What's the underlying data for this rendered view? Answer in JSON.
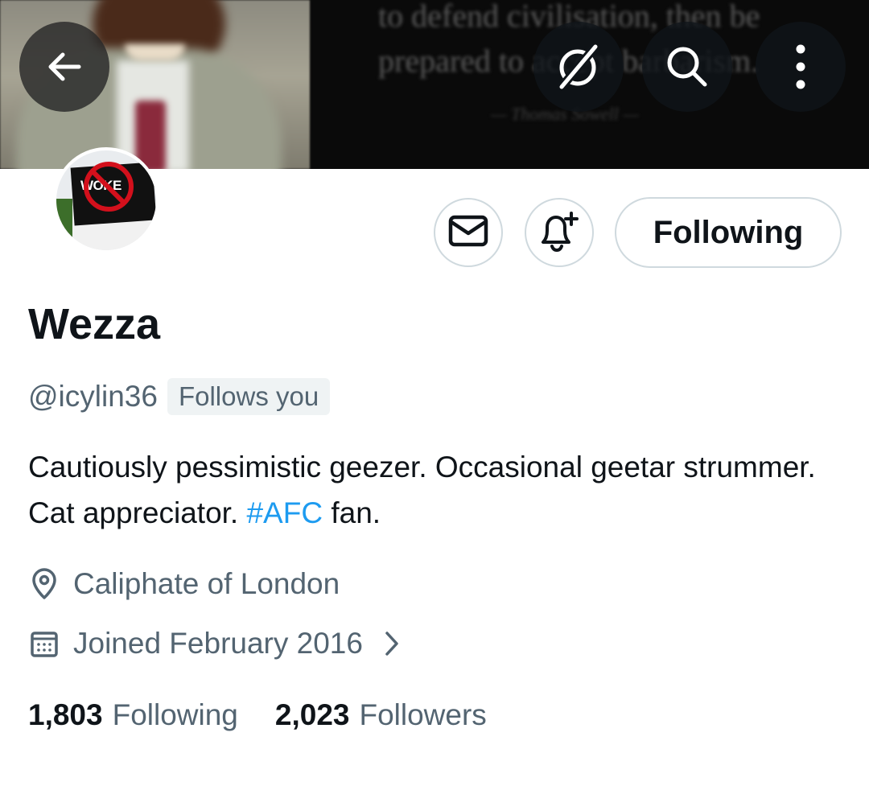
{
  "banner": {
    "quote_line1": "to defend civilisation, then be",
    "quote_line2": "prepared to accept barbarism.",
    "quote_cite": "— Thomas Sowell —"
  },
  "nav": {
    "back_icon": "arrow-left-icon",
    "grok_icon": "grok-icon",
    "search_icon": "search-icon",
    "more_icon": "more-vertical-icon"
  },
  "avatar": {
    "text": "WOKE"
  },
  "actions": {
    "message_icon": "mail-icon",
    "notify_icon": "bell-plus-icon",
    "follow_label": "Following"
  },
  "profile": {
    "display_name": "Wezza",
    "handle": "@icylin36",
    "follows_you": "Follows you",
    "bio_text": "Cautiously pessimistic geezer. Occasional geetar strummer. Cat appreciator. ",
    "bio_hashtag": "#AFC",
    "bio_end": " fan.",
    "location": "Caliphate of London",
    "joined": "Joined February 2016"
  },
  "stats": {
    "following_count": "1,803",
    "following_label": "Following",
    "followers_count": "2,023",
    "followers_label": "Followers"
  },
  "colors": {
    "text_primary": "#0f1419",
    "text_secondary": "#536471",
    "link": "#1d9bf0",
    "border": "#cfd9de"
  }
}
